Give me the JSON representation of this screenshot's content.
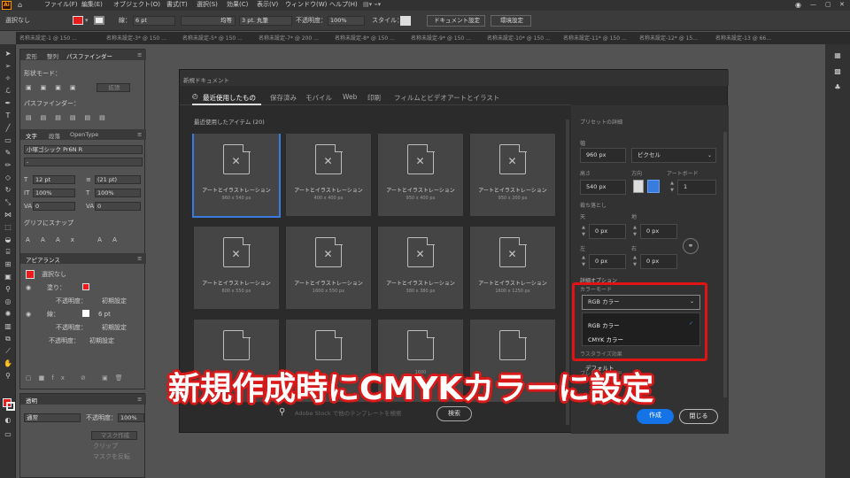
{
  "menubar": {
    "logo": "Ai",
    "items": [
      "ファイル(F)",
      "編集(E)",
      "オブジェクト(O)",
      "書式(T)",
      "選択(S)",
      "効果(C)",
      "表示(V)",
      "ウィンドウ(W)",
      "ヘルプ(H)"
    ]
  },
  "ctrlbar": {
    "selection": "選択なし",
    "stroke_label": "線：",
    "stroke_value": "6 pt",
    "stroke_style": "均等",
    "brush": "3 pt. 丸筆",
    "opacity_label": "不透明度：",
    "opacity_value": "100%",
    "style_label": "スタイル：",
    "doc_setup": "ドキュメント設定",
    "env_setup": "環境設定"
  },
  "doc_tabs": [
    "名称未設定-1 @ 150 ...",
    "名称未設定-3* @ 150 ...",
    "名称未設定-5* @ 150 ...",
    "名称未設定-7* @ 200 ...",
    "名称未設定-8* @ 150 ...",
    "名称未設定-9* @ 150 ...",
    "名称未設定-10* @ 150 ...",
    "名称未設定-11* @ 150 ...",
    "名称未設定-12* @ 15...",
    "名称未設定-13 @ 66..."
  ],
  "pathfinder": {
    "tabs": [
      "変形",
      "整列",
      "パスファインダー"
    ],
    "shape_modes": "形状モード：",
    "expand": "拡張",
    "pathfinders": "パスファインダー："
  },
  "character": {
    "tabs": [
      "文字",
      "段落",
      "OpenType"
    ],
    "font": "小塚ゴシック Pr6N R",
    "style": "-",
    "size": "12 pt",
    "leading": "(21 pt)",
    "hscale": "100%",
    "vscale": "100%",
    "kerning": "0",
    "tracking": "0",
    "snap": "グリフにスナップ"
  },
  "appearance": {
    "title": "アピアランス",
    "none": "選択なし",
    "fill_label": "塗り：",
    "stroke_label": "線：",
    "stroke_value": "6 pt",
    "opacity_label": "不透明度：",
    "opacity_value": "初期設定",
    "opacity2_label": "不透明度：",
    "opacity2_value": "初期設定",
    "opacity3_label": "不透明度：",
    "opacity3_value": "初期設定"
  },
  "transparency": {
    "title": "透明",
    "mode": "通常",
    "opacity_label": "不透明度：",
    "opacity_value": "100%",
    "make_mask": "マスク作成",
    "clip": "クリップ",
    "invert": "マスクを反転"
  },
  "dialog": {
    "title": "新規ドキュメント",
    "tabs": [
      "最近使用したもの",
      "保存済み",
      "モバイル",
      "Web",
      "印刷",
      "フィルムとビデオ",
      "アートとイラスト"
    ],
    "recent_header": "最近使用したアイテム (20)",
    "cards": [
      {
        "name": "アートとイラストレーション",
        "size": "960 x 540 px"
      },
      {
        "name": "アートとイラストレーション",
        "size": "400 x 400 px"
      },
      {
        "name": "アートとイラストレーション",
        "size": "950 x 400 px"
      },
      {
        "name": "アートとイラストレーション",
        "size": "950 x 200 px"
      },
      {
        "name": "アートとイラストレーション",
        "size": "800 x 550 px"
      },
      {
        "name": "アートとイラストレーション",
        "size": "1600 x 550 px"
      },
      {
        "name": "アートとイラストレーション",
        "size": "380 x 380 px"
      },
      {
        "name": "アートとイラストレーション",
        "size": "1600 x 1250 px"
      },
      {
        "name": "",
        "size": ""
      },
      {
        "name": "",
        "size": ""
      },
      {
        "name": "",
        "size": "1600"
      },
      {
        "name": "",
        "size": ""
      }
    ],
    "search_placeholder": "Adobe Stock で他のテンプレートを検索",
    "search_button": "検索"
  },
  "preset": {
    "header": "プリセットの詳細",
    "width_label": "幅",
    "width": "960 px",
    "unit": "ピクセル",
    "height_label": "高さ",
    "height": "540 px",
    "orient_label": "方向",
    "artboard_label": "アートボード",
    "artboards": "1",
    "bleed_label": "裁ち落とし",
    "top_label": "天",
    "top": "0 px",
    "bottom_label": "地",
    "bottom": "0 px",
    "left_label": "左",
    "left": "0 px",
    "right_label": "右",
    "right": "0 px",
    "advanced": "詳細オプション",
    "color_mode_label": "カラーモード",
    "color_mode": "RGB カラー",
    "options": [
      "RGB カラー",
      "CMYK カラー"
    ],
    "raster_label": "ラスタライズ効果",
    "preview_label": "プレビューモード",
    "preview": "デフォルト",
    "create": "作成",
    "close": "閉じる"
  },
  "banner": "新規作成時にCMYKカラーに設定",
  "colors": {
    "accent": "#3a7be0",
    "highlight": "#e01414",
    "fill_swatch": "#e81c1c"
  }
}
